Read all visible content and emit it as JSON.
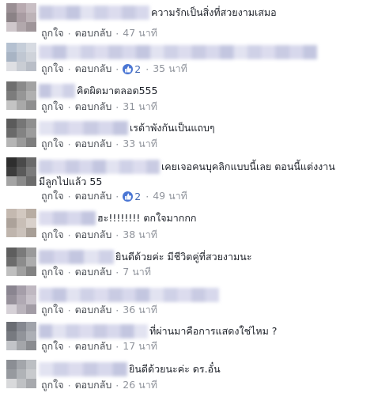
{
  "actions": {
    "like": "ถูกใจ",
    "reply": "ตอบกลับ",
    "sep": "·"
  },
  "colors": {
    "comment_text": "#1d2129",
    "meta_text": "#4b4f56",
    "time_text": "#90949c",
    "like_badge": "#4a76d4",
    "blur_blocks": [
      "#c9cbe3",
      "#d4d6ec",
      "#dfe0ef",
      "#e9e9f3"
    ]
  },
  "comments": [
    {
      "name_blur": true,
      "text": "ความรักเป็นสิ่งที่สวยงามเสมอ",
      "text_line2": "",
      "likes": "",
      "time": "47 นาที"
    },
    {
      "name_blur": true,
      "text": "",
      "text_line2": "",
      "likes": "2",
      "time": "35 นาที"
    },
    {
      "name_blur": true,
      "text": "คิดผิดมาตลอด555",
      "text_line2": "",
      "likes": "",
      "time": "31 นาที"
    },
    {
      "name_blur": true,
      "text": "เรด้าพังกันเป็นแถบๆ",
      "text_line2": "",
      "likes": "",
      "time": "33 นาที"
    },
    {
      "name_blur": true,
      "text": "เคยเจอคนบุคลิกแบบนี้เลย ตอนนี้แต่งงาน",
      "text_line2": "มีลูกไปแล้ว 55",
      "likes": "2",
      "time": "49 นาที"
    },
    {
      "name_blur": true,
      "text": "ฮะ!!!!!!!! ตกใจมากกก",
      "text_line2": "",
      "likes": "",
      "time": "38 นาที"
    },
    {
      "name_blur": true,
      "text": "ยินดีด้วยค่ะ มีชีวิตคู่ที่สวยงามนะ",
      "text_line2": "",
      "likes": "",
      "time": "7 นาที"
    },
    {
      "name_blur": true,
      "text": "",
      "text_line2": "",
      "likes": "",
      "time": "36 นาที"
    },
    {
      "name_blur": true,
      "text": "ที่ผ่านมาคือการแสดงใช่ไหม ?",
      "text_line2": "",
      "likes": "",
      "time": "17 นาที"
    },
    {
      "name_blur": true,
      "text": "ยินดีด้วยนะค่ะ ดร.อั๋น",
      "text_line2": "",
      "likes": "",
      "time": "26 นาที"
    }
  ]
}
